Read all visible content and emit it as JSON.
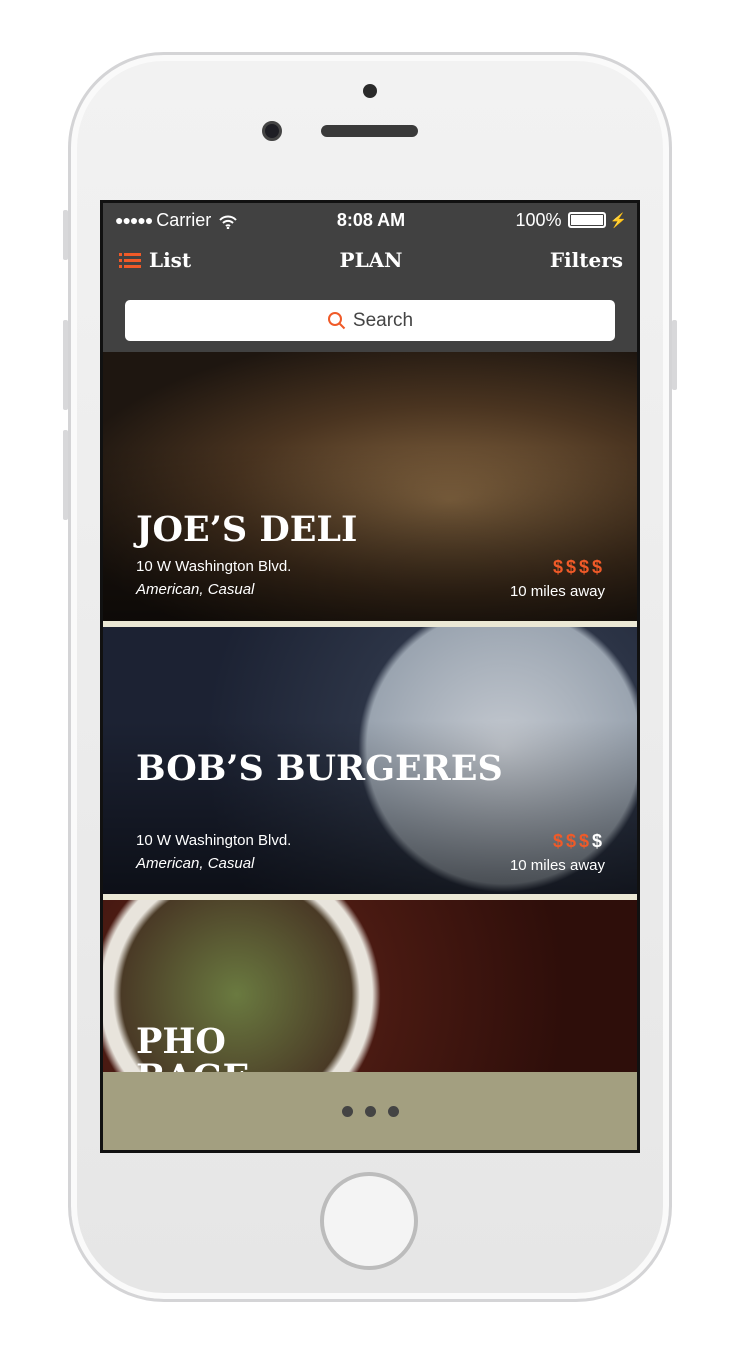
{
  "status": {
    "signal": "●●●●●",
    "carrier": "Carrier",
    "time": "8:08 AM",
    "battery": "100%"
  },
  "nav": {
    "list_label": "List",
    "title": "PLAN",
    "filters_label": "Filters"
  },
  "search": {
    "placeholder": "Search"
  },
  "accent": "#f05a28",
  "restaurants": [
    {
      "name": "JOE’S DELI",
      "address": "10 W Washington Blvd.",
      "category": "American, Casual",
      "price_active": "$$$$",
      "price_inactive": "",
      "distance": "10 miles away"
    },
    {
      "name": "BOB’S BURGERES",
      "address": "10 W Washington Blvd.",
      "category": "American, Casual",
      "price_active": "$$$",
      "price_inactive": "$",
      "distance": "10 miles away"
    },
    {
      "name": "PHO BAGE"
    }
  ],
  "pagination": {
    "icon": "more-dots-icon"
  }
}
